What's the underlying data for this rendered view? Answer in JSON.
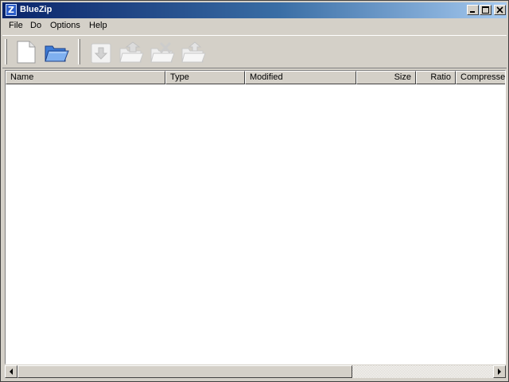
{
  "window": {
    "title": "BlueZip",
    "app_icon_glyph": "Z"
  },
  "menu": {
    "items": [
      "File",
      "Do",
      "Options",
      "Help"
    ]
  },
  "toolbar": {
    "buttons": [
      {
        "icon": "new-archive-icon",
        "enabled": true
      },
      {
        "icon": "open-folder-icon",
        "enabled": true
      },
      {
        "icon": "add-files-icon",
        "enabled": false
      },
      {
        "icon": "extract-icon",
        "enabled": false
      },
      {
        "icon": "delete-files-icon",
        "enabled": false
      },
      {
        "icon": "test-archive-icon",
        "enabled": false
      }
    ]
  },
  "list": {
    "columns": [
      "Name",
      "Type",
      "Modified",
      "Size",
      "Ratio",
      "Compressed"
    ],
    "rows": []
  },
  "colors": {
    "title_start": "#0a246a",
    "title_end": "#a6caf0",
    "face": "#d4d0c8"
  }
}
